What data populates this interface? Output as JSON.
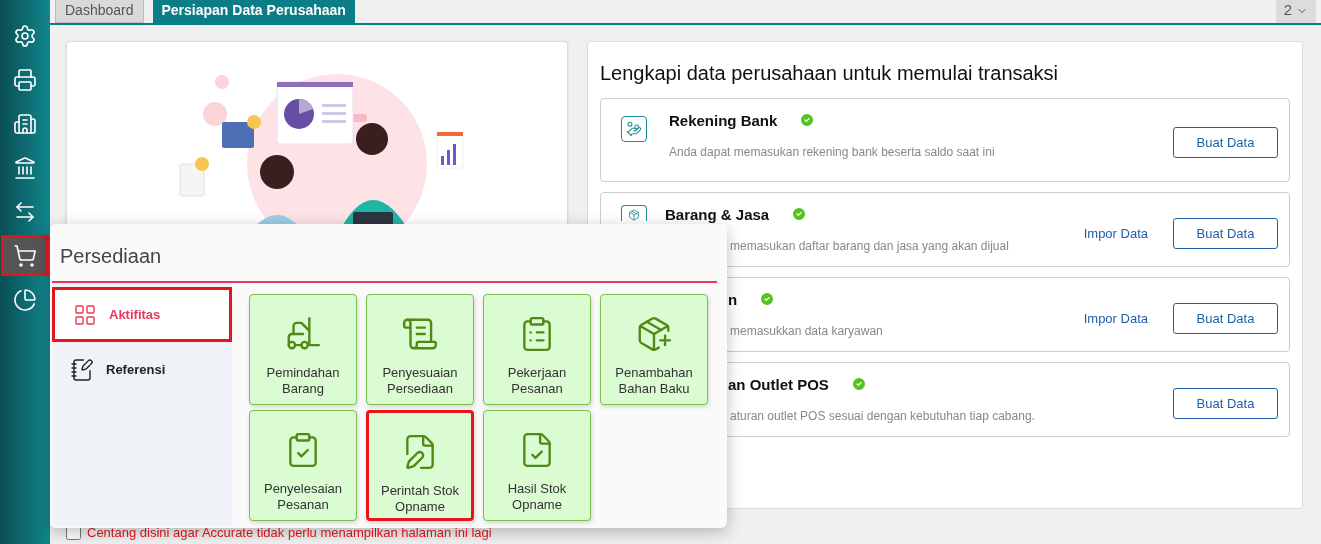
{
  "sidebar": {
    "items": [
      {
        "selected": false
      },
      {
        "selected": false
      },
      {
        "selected": false
      },
      {
        "selected": false
      },
      {
        "selected": false
      },
      {
        "selected": true
      },
      {
        "selected": false
      }
    ]
  },
  "tabs": [
    {
      "label": "Dashboard",
      "selected": false
    },
    {
      "label": "Persiapan Data Perusahaan",
      "selected": true
    }
  ],
  "tab_overflow": {
    "label": "2"
  },
  "setup": {
    "title": "Lengkapi data perusahaan untuk memulai transaksi",
    "cards": [
      {
        "kind": "full",
        "title": "Rekening Bank",
        "completed": true,
        "description": "Anda dapat memasukan rekening bank beserta saldo saat ini",
        "actions": [
          "Buat Data"
        ]
      },
      {
        "kind": "cut",
        "title": "Barang & Jasa",
        "completed": true,
        "description": "memasukan daftar barang dan jasa yang akan dijual",
        "actions": [
          "Impor Data",
          "Buat Data"
        ]
      },
      {
        "kind": "hidden",
        "title": "n",
        "completed": true,
        "description": "memasukkan data karyawan",
        "actions": [
          "Impor Data",
          "Buat Data"
        ]
      },
      {
        "kind": "hidden",
        "title": "an Outlet POS",
        "completed": true,
        "description": "aturan outlet POS sesuai dengan kebutuhan tiap cabang.",
        "actions": [
          "Buat Data"
        ]
      }
    ]
  },
  "dont_show": {
    "label": "Centang disini agar Accurate tidak perlu menampilkan halaman ini lagi",
    "checked": false
  },
  "popup": {
    "title": "Persediaan",
    "nav": [
      {
        "label": "Aktifitas",
        "selected": true,
        "highlighted": true
      },
      {
        "label": "Referensi",
        "selected": false,
        "highlighted": false
      }
    ],
    "tiles": [
      {
        "label": "Pemindahan Barang",
        "highlighted": false
      },
      {
        "label": "Penyesuaian Persediaan",
        "highlighted": false
      },
      {
        "label": "Pekerjaan Pesanan",
        "highlighted": false
      },
      {
        "label": "Penambahan Bahan Baku",
        "highlighted": false
      },
      {
        "label": "Penyelesaian Pesanan",
        "highlighted": false
      },
      {
        "label": "Perintah Stok Opname",
        "highlighted": true
      },
      {
        "label": "Hasil Stok Opname",
        "highlighted": false
      }
    ]
  }
}
